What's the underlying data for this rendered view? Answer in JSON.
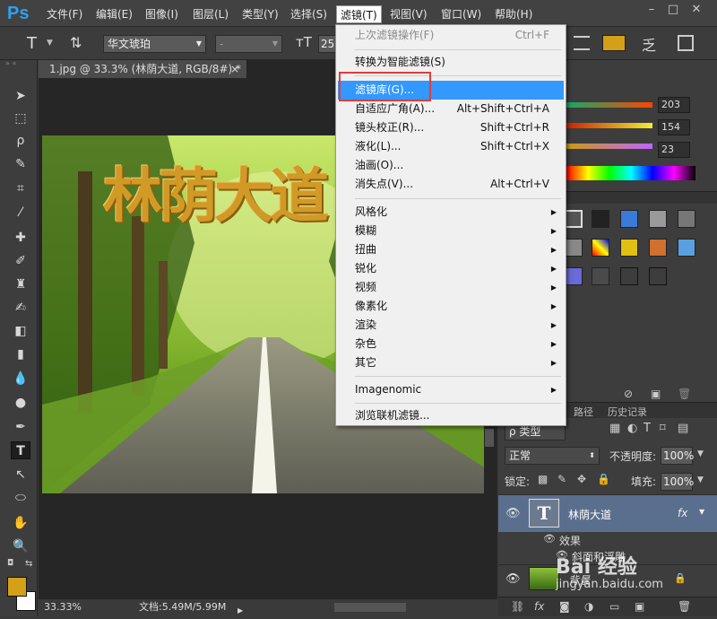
{
  "menubar": {
    "logo": "Ps",
    "items": [
      "文件(F)",
      "编辑(E)",
      "图像(I)",
      "图层(L)",
      "类型(Y)",
      "选择(S)",
      "滤镜(T)",
      "视图(V)",
      "窗口(W)",
      "帮助(H)"
    ],
    "window_buttons": [
      "–",
      "□",
      "✕"
    ]
  },
  "optionsbar": {
    "tool_glyph": "T",
    "font_family": "华文琥珀",
    "font_style": "-",
    "font_size": "25",
    "color": "#d4a017"
  },
  "document": {
    "tab_title": "1.jpg @ 33.3% (林荫大道, RGB/8#) *",
    "tab_close": "×",
    "canvas_text": "林荫大道",
    "zoom": "33.33%",
    "doc_size": "文档:5.49M/5.99M"
  },
  "filter_menu": {
    "items": [
      {
        "label": "上次滤镜操作(F)",
        "shortcut": "Ctrl+F",
        "disabled": true
      },
      {
        "label": "转换为智能滤镜(S)",
        "shortcut": ""
      },
      {
        "label": "滤镜库(G)...",
        "shortcut": "",
        "highlighted": true
      },
      {
        "label": "自适应广角(A)...",
        "shortcut": "Alt+Shift+Ctrl+A"
      },
      {
        "label": "镜头校正(R)...",
        "shortcut": "Shift+Ctrl+R"
      },
      {
        "label": "液化(L)...",
        "shortcut": "Shift+Ctrl+X"
      },
      {
        "label": "油画(O)...",
        "shortcut": ""
      },
      {
        "label": "消失点(V)...",
        "shortcut": "Alt+Ctrl+V"
      },
      {
        "label": "风格化",
        "submenu": true
      },
      {
        "label": "模糊",
        "submenu": true
      },
      {
        "label": "扭曲",
        "submenu": true
      },
      {
        "label": "锐化",
        "submenu": true
      },
      {
        "label": "视频",
        "submenu": true
      },
      {
        "label": "像素化",
        "submenu": true
      },
      {
        "label": "渲染",
        "submenu": true
      },
      {
        "label": "杂色",
        "submenu": true
      },
      {
        "label": "其它",
        "submenu": true
      },
      {
        "label": "Imagenomic",
        "submenu": true
      },
      {
        "label": "浏览联机滤镜...",
        "shortcut": ""
      }
    ]
  },
  "color_panel": {
    "values": [
      "203",
      "154",
      "23"
    ]
  },
  "layers_panel": {
    "tabs": [
      "路径",
      "历史记录"
    ],
    "kind_filter": "ρ 类型",
    "blend_mode": "正常",
    "opacity_label": "不透明度:",
    "opacity_value": "100%",
    "lock_label": "锁定:",
    "fill_label": "填充:",
    "fill_value": "100%",
    "layers": [
      {
        "name": "林荫大道",
        "type": "text",
        "fx": "fx"
      },
      {
        "name": "效果",
        "type": "effect"
      },
      {
        "name": "斜面和浮雕",
        "type": "effect-item"
      },
      {
        "name": "背景",
        "type": "image"
      }
    ]
  },
  "watermark": {
    "brand": "Bai 经验",
    "url": "jingyan.baidu.com"
  },
  "colors": {
    "foreground": "#d4a017",
    "background": "#ffffff",
    "menu_highlight": "#3399ff",
    "callout": "#e23b3b"
  }
}
